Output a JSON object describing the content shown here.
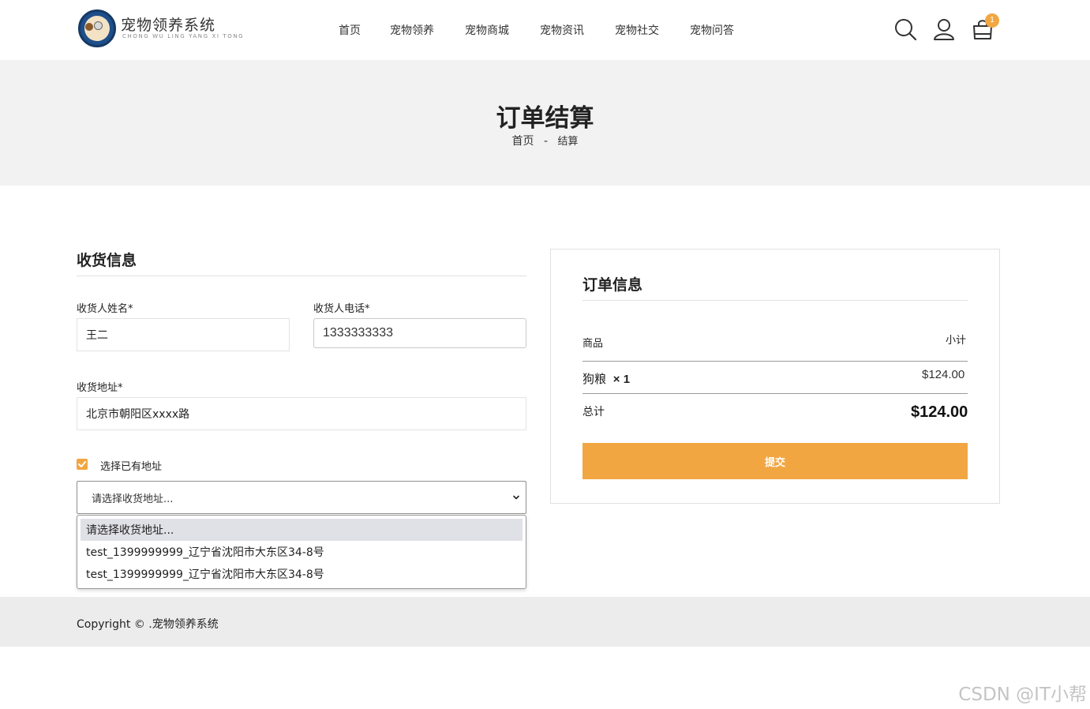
{
  "header": {
    "logo_title": "宠物领养系统",
    "logo_subtitle": "CHONG WU LING YANG XI TONG",
    "nav": [
      "首页",
      "宠物领养",
      "宠物商城",
      "宠物资讯",
      "宠物社交",
      "宠物问答"
    ],
    "cart_count": "1"
  },
  "banner": {
    "title": "订单结算",
    "crumb_home": "首页",
    "crumb_sep": "-",
    "crumb_current": "结算"
  },
  "shipping": {
    "title": "收货信息",
    "name_label": "收货人姓名*",
    "name_value": "王二",
    "phone_label": "收货人电话*",
    "phone_value": "1333333333",
    "address_label": "收货地址*",
    "address_value": "北京市朝阳区xxxx路",
    "use_saved_label": "选择已有地址",
    "use_saved_checked": true,
    "select_placeholder": "请选择收货地址...",
    "options": [
      "请选择收货地址...",
      "test_1399999999_辽宁省沈阳市大东区34-8号",
      "test_1399999999_辽宁省沈阳市大东区34-8号"
    ]
  },
  "order": {
    "title": "订单信息",
    "col_product": "商品",
    "col_subtotal": "小计",
    "item_name": "狗粮",
    "item_qty": "× 1",
    "item_price": "$124.00",
    "total_label": "总计",
    "total_value": "$124.00",
    "submit_label": "提交"
  },
  "footer": {
    "copyright": "Copyright © .宠物领养系统"
  },
  "watermark": "CSDN @IT小帮",
  "colors": {
    "accent": "#f2a642",
    "banner_bg": "#f2f2f2",
    "footer_bg": "#ececec"
  }
}
